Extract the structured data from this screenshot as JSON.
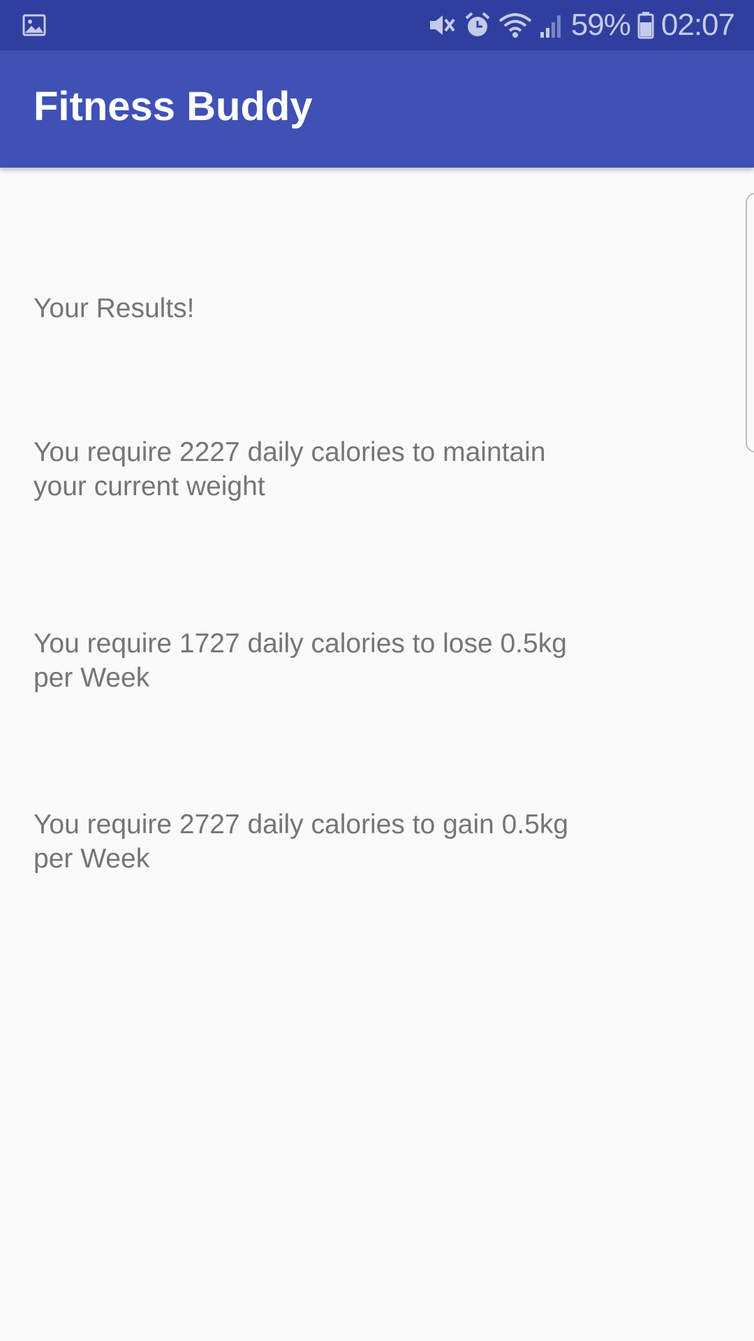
{
  "status_bar": {
    "left_icon": "image-icon",
    "icons": [
      "mute-icon",
      "alarm-icon",
      "wifi-icon",
      "signal-icon"
    ],
    "battery_percent": "59%",
    "battery_icon": "battery-icon",
    "time": "02:07"
  },
  "app_bar": {
    "title": "Fitness Buddy",
    "color": "#3f51b5"
  },
  "results": {
    "heading": "Your Results!",
    "maintain": "You require 2227 daily calories to maintain your current weight",
    "lose": "You require 1727 daily calories to lose 0.5kg per Week",
    "gain": "You require 2727 daily calories to gain 0.5kg per Week"
  },
  "colors": {
    "status_bar": "#303f9f",
    "accent": "#3f51b5",
    "text": "#757575",
    "background": "#fafafa"
  }
}
